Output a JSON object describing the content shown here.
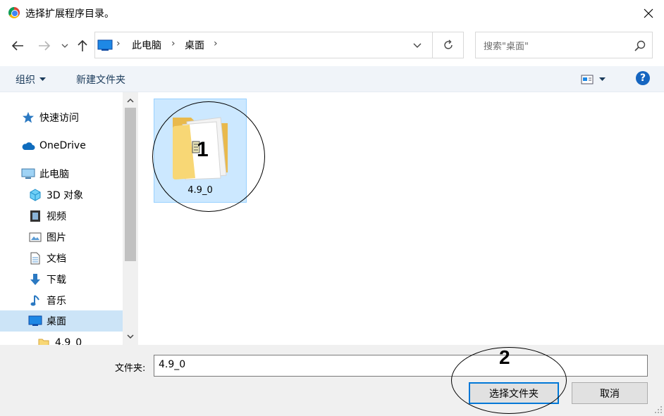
{
  "window": {
    "title": "选择扩展程序目录。"
  },
  "nav": {
    "breadcrumb": [
      "此电脑",
      "桌面"
    ],
    "search_placeholder": "搜索\"桌面\""
  },
  "toolbar": {
    "organize_label": "组织",
    "new_folder_label": "新建文件夹",
    "help_label": "?"
  },
  "sidebar": {
    "items": [
      {
        "label": "快速访问",
        "icon": "star-icon"
      },
      {
        "label": "OneDrive",
        "icon": "cloud-icon"
      },
      {
        "label": "此电脑",
        "icon": "computer-icon"
      },
      {
        "label": "3D 对象",
        "icon": "cube-icon"
      },
      {
        "label": "视频",
        "icon": "video-icon"
      },
      {
        "label": "图片",
        "icon": "picture-icon"
      },
      {
        "label": "文档",
        "icon": "document-icon"
      },
      {
        "label": "下载",
        "icon": "download-icon"
      },
      {
        "label": "音乐",
        "icon": "music-icon"
      },
      {
        "label": "桌面",
        "icon": "desktop-icon",
        "selected": true
      },
      {
        "label": "4.9_0",
        "icon": "folder-icon"
      }
    ]
  },
  "content": {
    "items": [
      {
        "name": "4.9_0",
        "type": "folder",
        "selected": true
      }
    ]
  },
  "footer": {
    "folder_label": "文件夹:",
    "folder_value": "4.9_0",
    "select_button": "选择文件夹",
    "cancel_button": "取消"
  },
  "annotations": {
    "marker_1": "1",
    "marker_2": "2"
  },
  "colors": {
    "selection": "#cce8ff",
    "selection_border": "#99d1ff",
    "accent": "#0078d7",
    "toolbar_bg": "#f0f4f9",
    "footer_bg": "#f0f0f0"
  }
}
